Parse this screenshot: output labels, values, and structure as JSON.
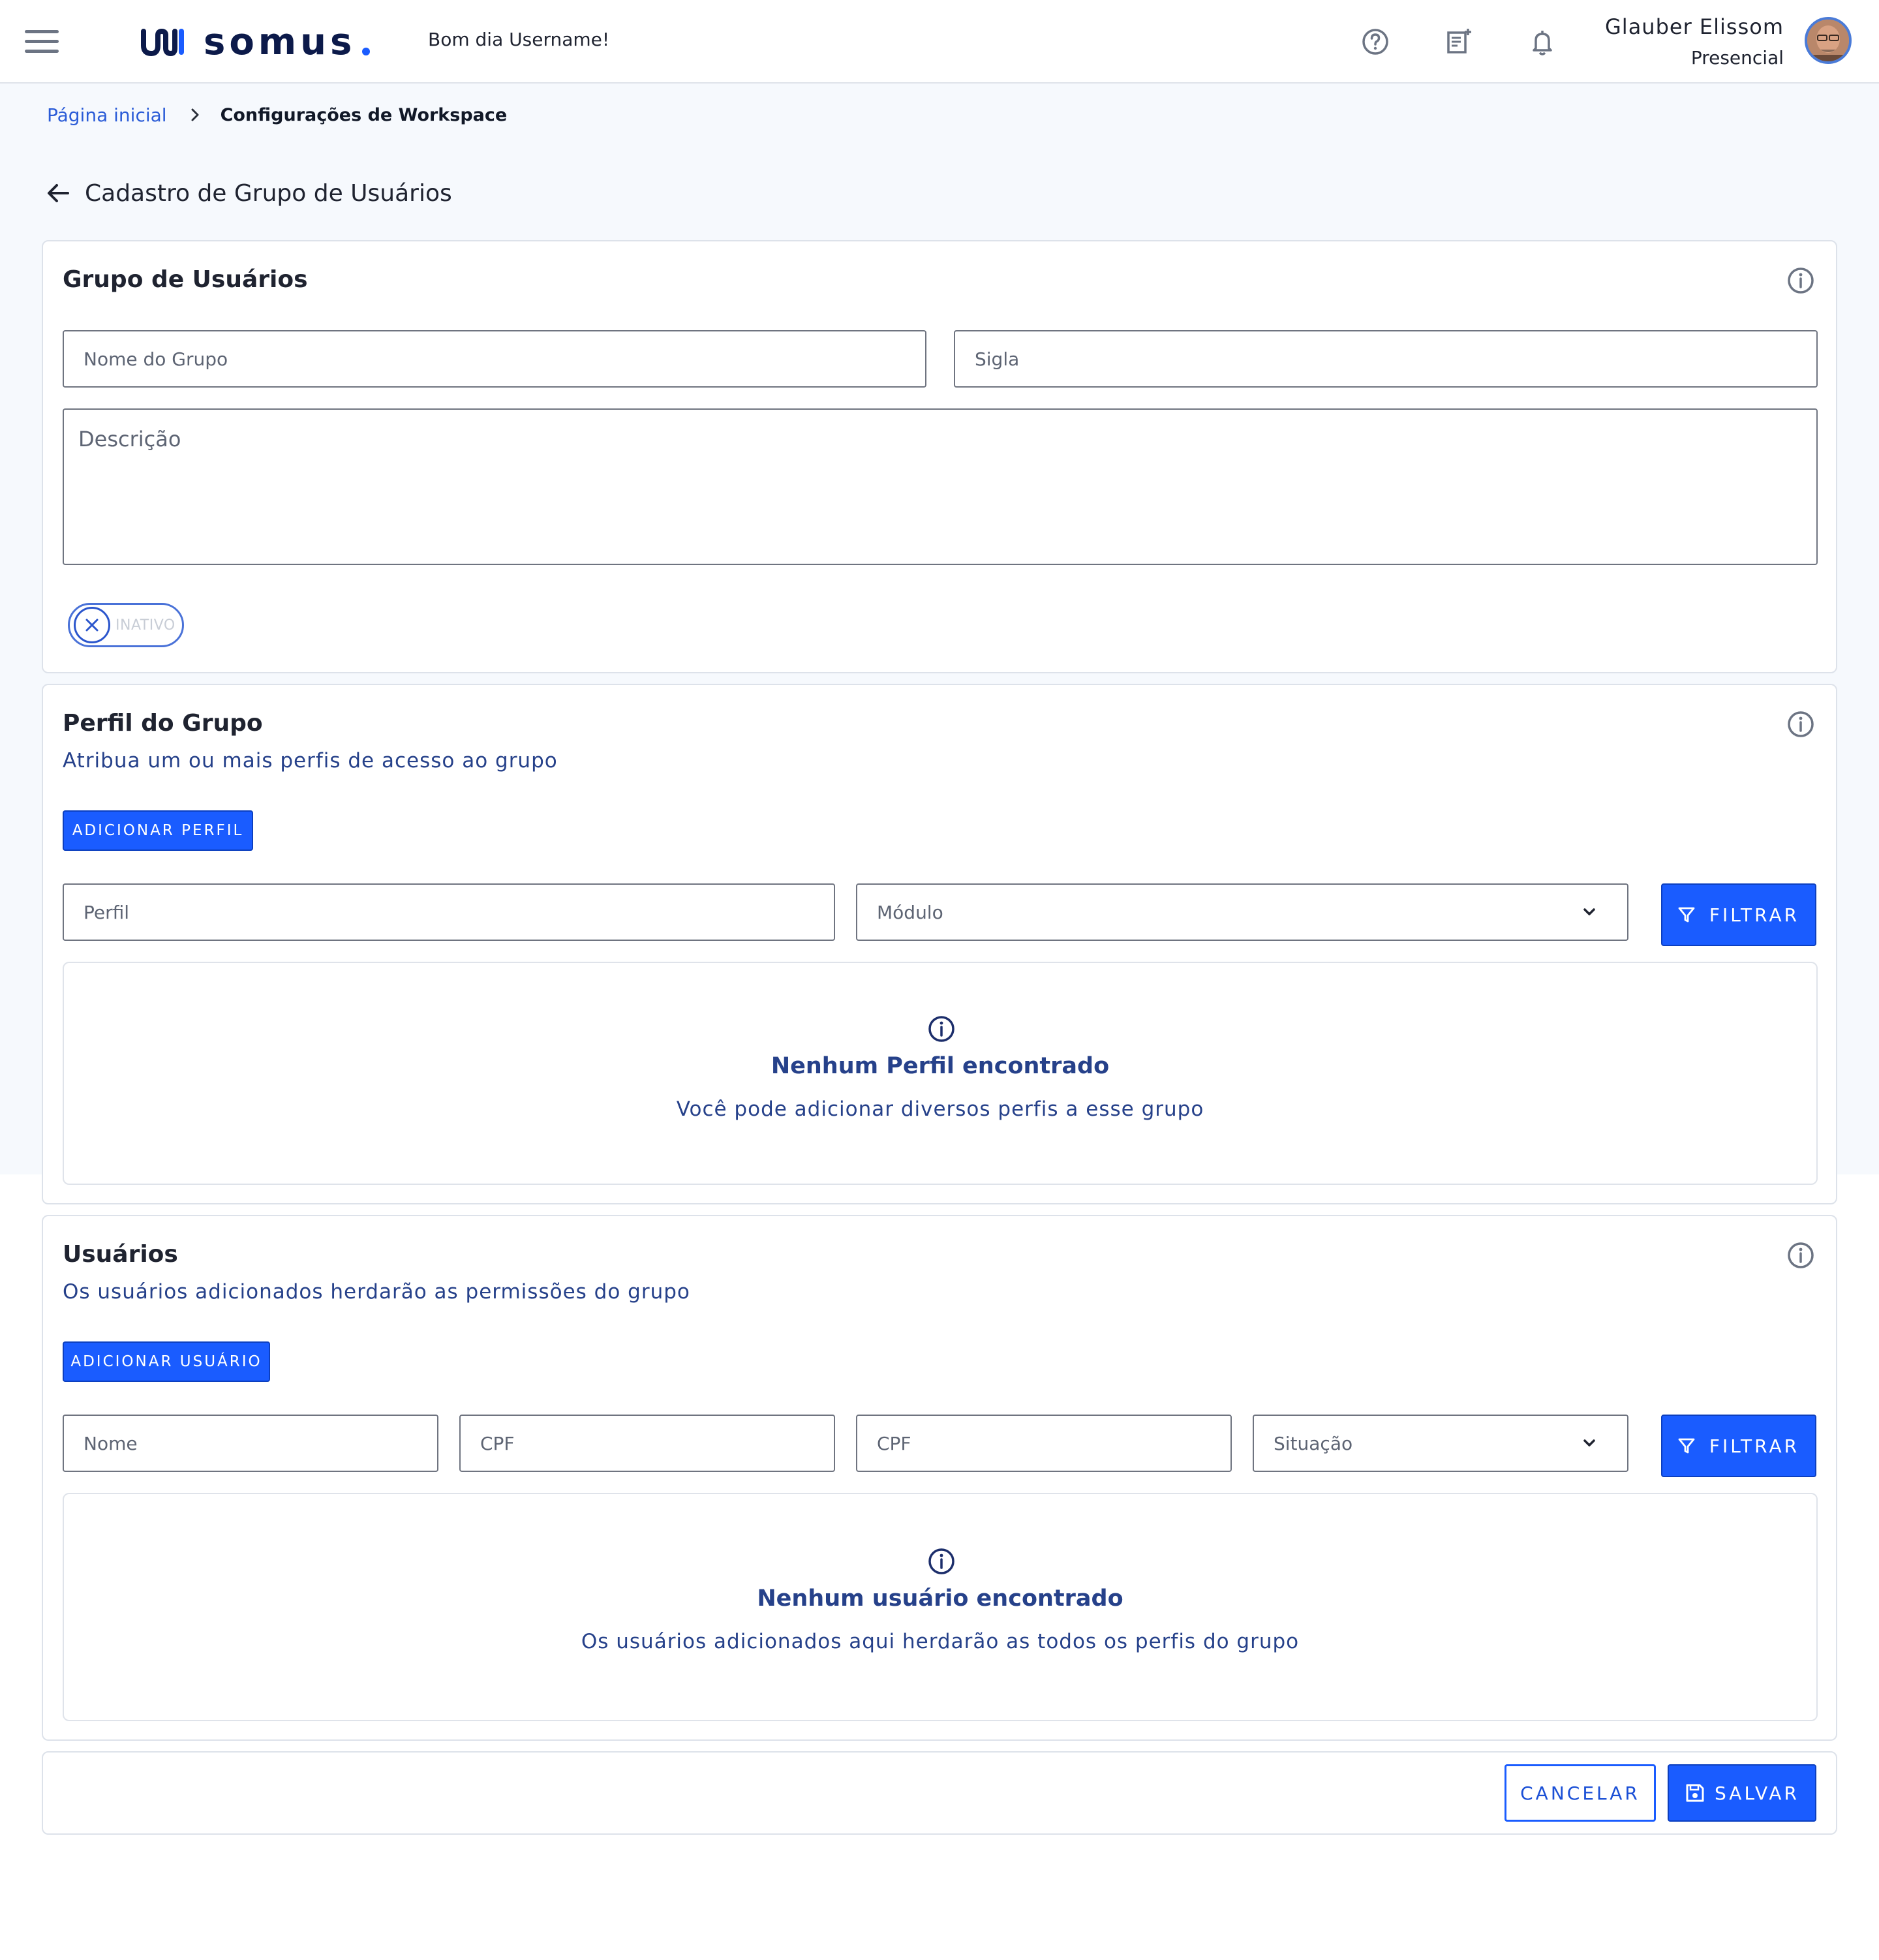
{
  "header": {
    "logo_text": "somus",
    "greeting_prefix": "Bom dia",
    "greeting_name": "Username!",
    "user_name": "Glauber Elissom",
    "user_status": "Presencial",
    "icons": [
      "menu-icon",
      "help-icon",
      "notes-add-icon",
      "bell-icon",
      "avatar"
    ]
  },
  "breadcrumb": {
    "home": "Página inicial",
    "current": "Configurações de Workspace"
  },
  "page": {
    "title": "Cadastro de Grupo de Usuários"
  },
  "group_card": {
    "title": "Grupo de Usuários",
    "name_placeholder": "Nome do Grupo",
    "acronym_placeholder": "Sigla",
    "description_placeholder": "Descrição",
    "status_label": "INATIVO"
  },
  "profile_card": {
    "title": "Perfil do Grupo",
    "subtitle": "Atribua um ou mais perfis de acesso ao grupo",
    "add_button": "ADICIONAR PERFIL",
    "profile_placeholder": "Perfil",
    "module_placeholder": "Módulo",
    "filter_button": "FILTRAR",
    "empty_title": "Nenhum Perfil encontrado",
    "empty_subtitle": "Você pode adicionar diversos perfis a esse grupo"
  },
  "users_card": {
    "title": "Usuários",
    "subtitle": "Os usuários adicionados herdarão as permissões do grupo",
    "add_button": "ADICIONAR USUÁRIO",
    "name_placeholder": "Nome",
    "cpf_placeholder_1": "CPF",
    "cpf_placeholder_2": "CPF",
    "status_placeholder": "Situação",
    "filter_button": "FILTRAR",
    "empty_title": "Nenhum usuário encontrado",
    "empty_subtitle": "Os usuários adicionados aqui herdarão as todos os perfis do grupo"
  },
  "footer": {
    "cancel_button": "CANCELAR",
    "save_button": "SALVAR"
  },
  "colors": {
    "primary": "#1a5cff",
    "brand_dark": "#0c1a4a",
    "accent_text": "#26418a",
    "page_bg": "#f6f9fd"
  }
}
